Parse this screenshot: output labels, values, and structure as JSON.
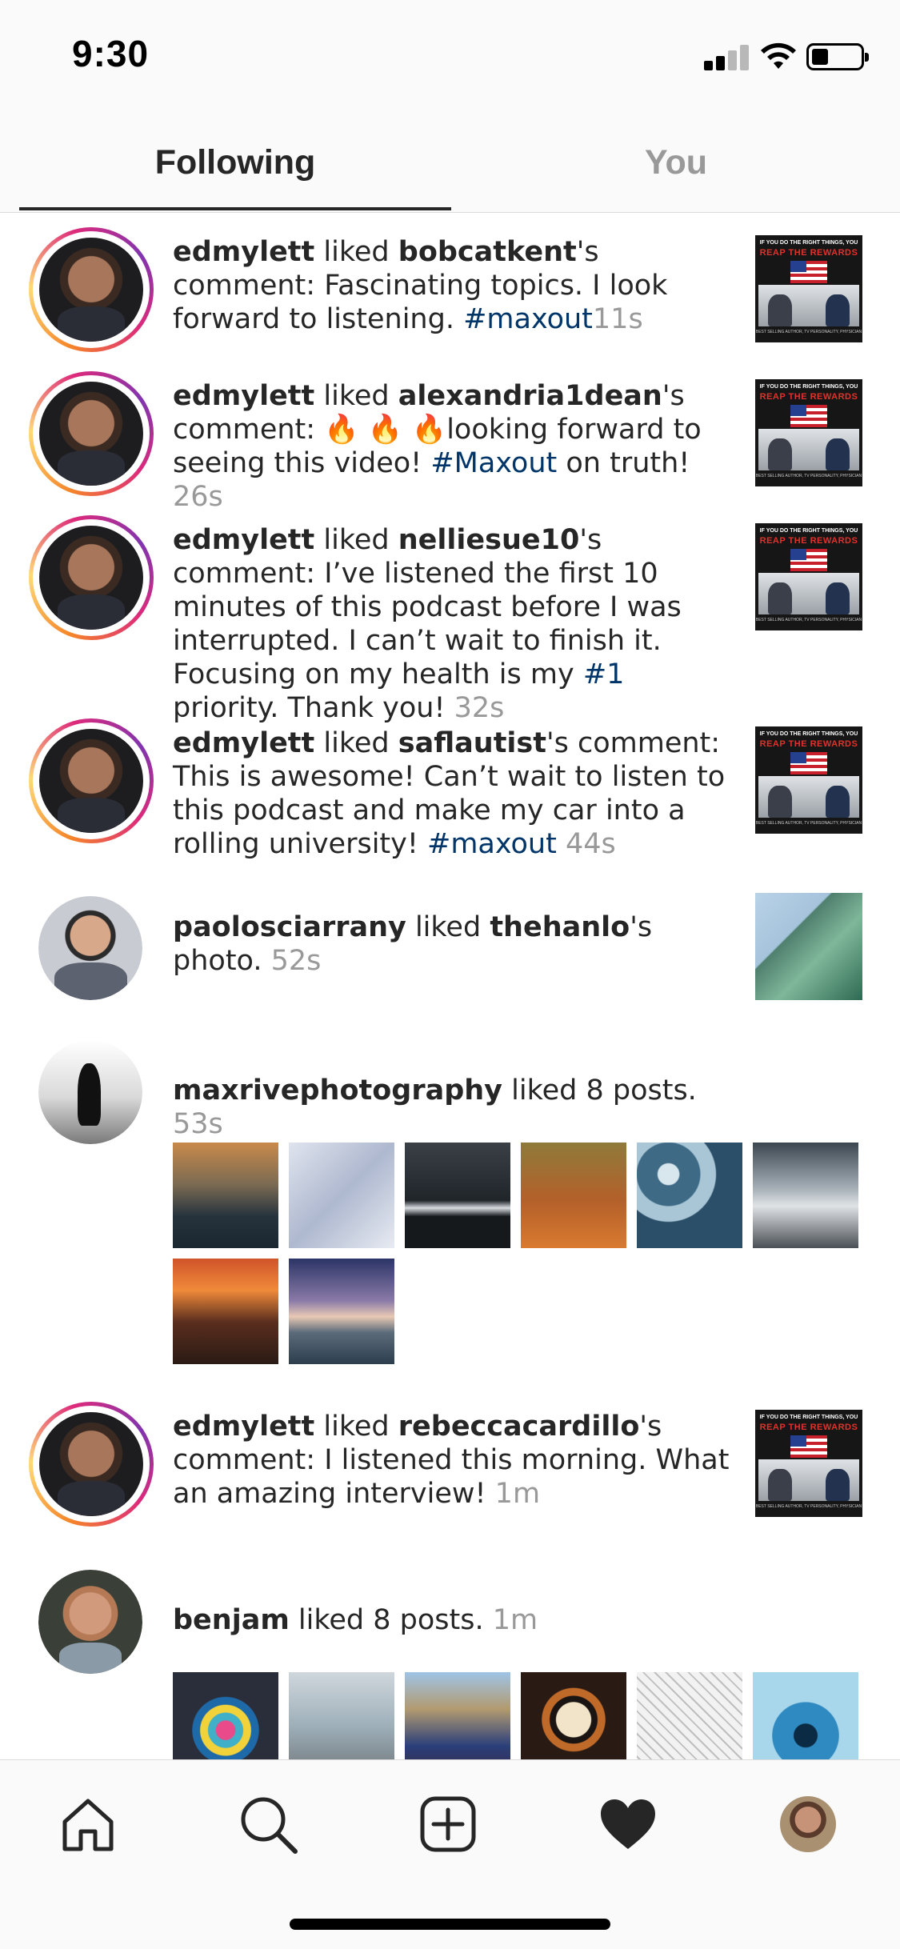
{
  "status_bar": {
    "time": "9:30"
  },
  "tabs": {
    "following": "Following",
    "you": "You"
  },
  "feed": [
    {
      "kind": "comment_like",
      "user": "edmylett",
      "verb": " liked ",
      "target": "bobcatkent",
      "suffix": "'s comment: ",
      "body": "Fascinating topics. I look forward to listening.  ",
      "tag": "#maxout",
      "after": "",
      "time": "11s"
    },
    {
      "kind": "comment_like",
      "user": "edmylett",
      "verb": " liked ",
      "target": "alexandria1dean",
      "suffix": "'s comment: ",
      "body": "🔥 🔥 🔥looking forward to seeing this video! ",
      "tag": "#Maxout",
      "after": " on truth! ",
      "time": "26s"
    },
    {
      "kind": "comment_like",
      "user": "edmylett",
      "verb": " liked ",
      "target": "nelliesue10",
      "suffix": "'s comment: ",
      "body": "I’ve listened the first 10 minutes of this podcast before I was interrupted.  I can’t wait to finish it.  Focusing on my health is my ",
      "tag": "#1",
      "after": " priority.  Thank you! ",
      "time": "32s"
    },
    {
      "kind": "comment_like",
      "user": "edmylett",
      "verb": " liked ",
      "target": "saflautist",
      "suffix": "'s comment: ",
      "body": "This is awesome! Can’t wait to listen to this podcast and make my car into a rolling university! ",
      "tag": "#maxout",
      "after": " ",
      "time": "44s"
    },
    {
      "kind": "photo_like",
      "user": "paolosciarrany",
      "verb": " liked ",
      "target": "thehanlo",
      "suffix": "'s photo. ",
      "time": "52s"
    },
    {
      "kind": "posts_like",
      "user": "maxrivephotography",
      "text": " liked 8 posts. ",
      "time": "53s"
    },
    {
      "kind": "comment_like",
      "user": "edmylett",
      "verb": " liked ",
      "target": "rebeccacardillo",
      "suffix": "'s comment: ",
      "body": "I listened this morning. What an amazing interview! ",
      "tag": "",
      "after": "",
      "time": "1m"
    },
    {
      "kind": "posts_like",
      "user": "benjam",
      "text": " liked 8 posts. ",
      "time": "1m"
    }
  ],
  "thumbnail": {
    "headline_top": "IF YOU DO THE RIGHT THINGS, YOU",
    "headline_main": "REAP THE REWARDS",
    "footer": "BEST SELLING AUTHOR, TV PERSONALITY, PHYSICIAN"
  },
  "colors": {
    "text": "#262626",
    "secondary": "#999999",
    "hashtag": "#003569",
    "divider": "#dbdbdb",
    "bar_bg": "#fafafa"
  },
  "bottom_nav": [
    "home-icon",
    "search-icon",
    "new-post-icon",
    "activity-heart-icon",
    "profile-avatar"
  ]
}
